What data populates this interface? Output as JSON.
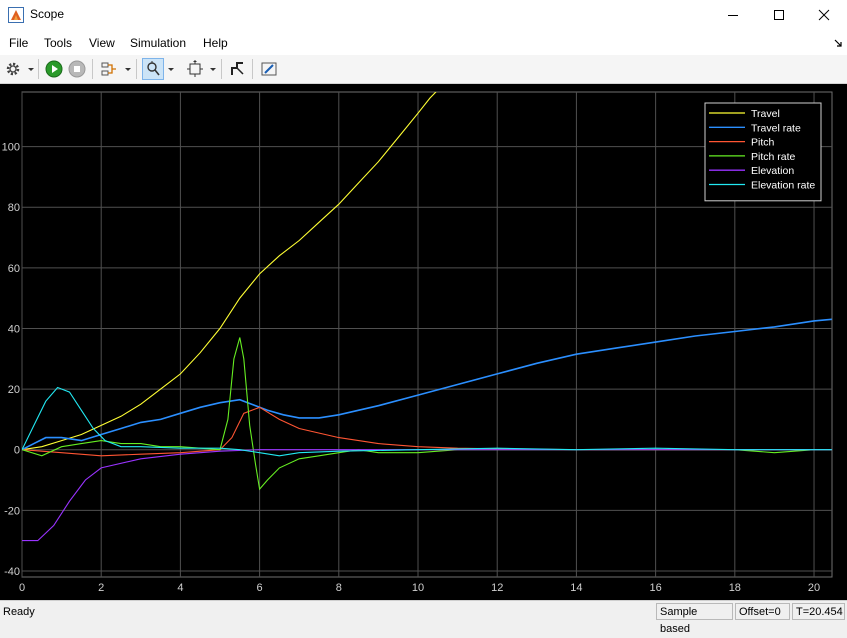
{
  "window": {
    "title": "Scope"
  },
  "menu": [
    "File",
    "Tools",
    "View",
    "Simulation",
    "Help"
  ],
  "toolbar": {
    "icons": [
      "gear-icon",
      "run-icon",
      "stop-icon",
      "signal-selector-icon",
      "zoom-icon",
      "fit-to-view-icon",
      "data-cursor-icon",
      "highlight-icon"
    ]
  },
  "status": {
    "ready": "Ready",
    "sample": "Sample based",
    "offset": "Offset=0",
    "time": "T=20.454"
  },
  "colors": {
    "background": "#000000",
    "grid": "#505050",
    "axis_text": "#d0d0d0"
  },
  "chart_data": {
    "type": "line",
    "title": "",
    "xlabel": "",
    "ylabel": "",
    "xlim": [
      0,
      20.454
    ],
    "ylim": [
      -42,
      118
    ],
    "xticks": [
      0,
      2,
      4,
      6,
      8,
      10,
      12,
      14,
      16,
      18,
      20
    ],
    "yticks": [
      -40,
      -20,
      0,
      20,
      40,
      60,
      80,
      100
    ],
    "grid": true,
    "legend_position": "top-right",
    "series": [
      {
        "name": "Travel",
        "color": "#ffff33",
        "x": [
          0,
          0.5,
          1,
          1.5,
          2,
          2.5,
          3,
          3.5,
          4,
          4.5,
          5,
          5.5,
          6,
          6.5,
          7,
          7.5,
          8,
          8.5,
          9,
          9.5,
          10,
          10.3,
          10.6
        ],
        "y": [
          0,
          1,
          3,
          5,
          8,
          11,
          15,
          20,
          25,
          32,
          40,
          50,
          58,
          64,
          69,
          75,
          81,
          88,
          95,
          103,
          111,
          116,
          120
        ]
      },
      {
        "name": "Travel rate",
        "color": "#2b8fff",
        "x": [
          0,
          0.3,
          0.6,
          1,
          1.5,
          2,
          2.5,
          3,
          3.5,
          4,
          4.5,
          5,
          5.5,
          5.8,
          6.2,
          6.6,
          7,
          7.5,
          8,
          9,
          10,
          11,
          12,
          13,
          14,
          15,
          16,
          17,
          18,
          19,
          20,
          20.45
        ],
        "y": [
          0,
          2,
          4,
          4,
          3,
          5,
          7,
          9,
          10,
          12,
          14,
          15.5,
          16.5,
          15,
          13,
          11.5,
          10.5,
          10.5,
          11.5,
          14.5,
          18,
          21.5,
          25,
          28.5,
          31.5,
          33.5,
          35.5,
          37.5,
          39,
          40.5,
          42.5,
          43
        ]
      },
      {
        "name": "Pitch",
        "color": "#ff5533",
        "x": [
          0,
          1,
          2,
          3,
          4,
          5,
          5.3,
          5.6,
          6,
          6.5,
          7,
          8,
          9,
          10,
          11,
          12,
          14,
          16,
          18,
          20,
          20.45
        ],
        "y": [
          0,
          -1,
          -2,
          -1.5,
          -1,
          0,
          4,
          12,
          14,
          10,
          7,
          4,
          2,
          1,
          0.5,
          0.3,
          0,
          0,
          0,
          0,
          0
        ]
      },
      {
        "name": "Pitch rate",
        "color": "#66ee22",
        "x": [
          0,
          0.5,
          1,
          1.5,
          2,
          2.5,
          3,
          3.5,
          4,
          4.5,
          5,
          5.2,
          5.35,
          5.5,
          5.6,
          5.75,
          5.9,
          6.0,
          6.2,
          6.5,
          7,
          7.5,
          8,
          8.5,
          9,
          10,
          11,
          12,
          13,
          14,
          15,
          16,
          17,
          18,
          19,
          20,
          20.45
        ],
        "y": [
          0,
          -2,
          1,
          2,
          3,
          2,
          2,
          1,
          1,
          0.5,
          0,
          10,
          30,
          37,
          30,
          8,
          -5,
          -13,
          -10,
          -6,
          -3,
          -2,
          -1,
          0,
          -1,
          -1,
          0,
          0,
          0,
          0,
          0,
          0,
          0,
          0,
          -1,
          0,
          0
        ]
      },
      {
        "name": "Elevation",
        "color": "#9933ff",
        "x": [
          0,
          0.4,
          0.8,
          1.2,
          1.6,
          2,
          3,
          4,
          5,
          6,
          8,
          10,
          14,
          20.45
        ],
        "y": [
          -30,
          -30,
          -25,
          -17,
          -10,
          -6,
          -3,
          -1.5,
          -0.5,
          0,
          0,
          0,
          0,
          0
        ]
      },
      {
        "name": "Elevation rate",
        "color": "#22e8f2",
        "x": [
          0,
          0.3,
          0.6,
          0.9,
          1.2,
          1.5,
          1.8,
          2.1,
          2.5,
          3,
          4,
          5,
          5.5,
          6,
          6.5,
          7,
          8,
          10,
          12,
          14,
          16,
          18,
          20,
          20.45
        ],
        "y": [
          0,
          8,
          16,
          20.5,
          19,
          13,
          7,
          3,
          1,
          1,
          0.5,
          0.5,
          0,
          -1,
          -2,
          -1,
          -0.5,
          0,
          0.5,
          0,
          0.5,
          0,
          0,
          0
        ]
      }
    ]
  }
}
